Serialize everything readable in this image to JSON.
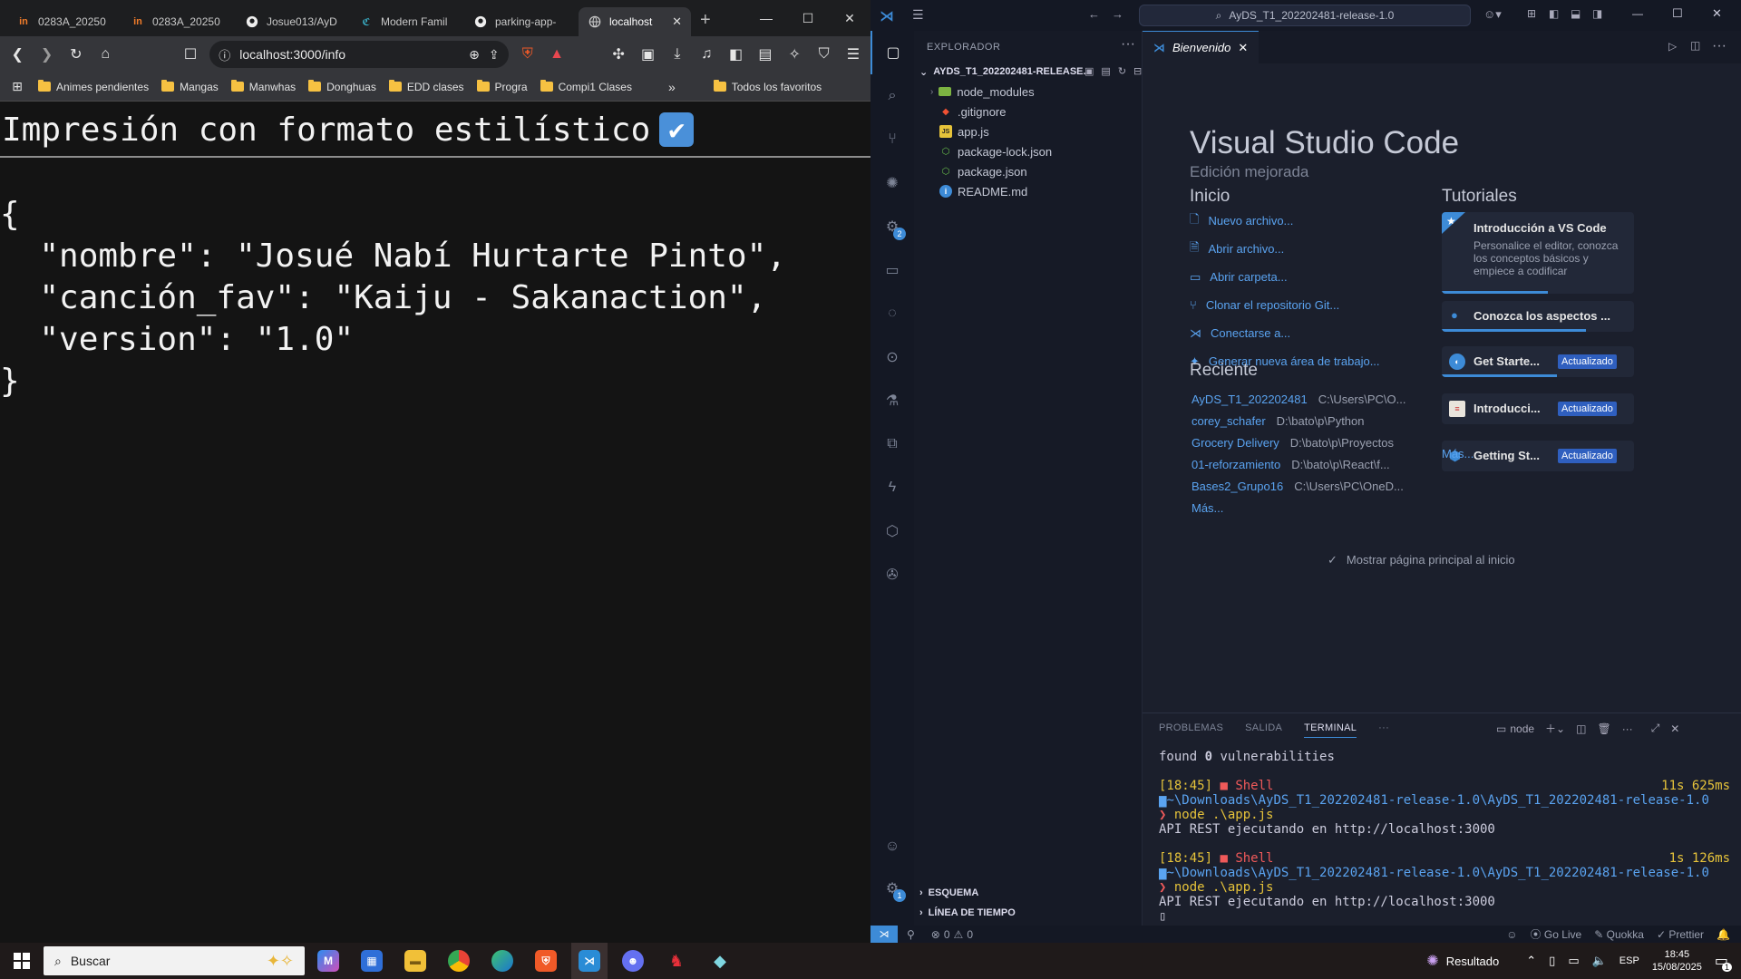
{
  "browser": {
    "tabs": [
      {
        "icon": "in",
        "label": "0283A_20250"
      },
      {
        "icon": "in",
        "label": "0283A_20250"
      },
      {
        "icon": "github",
        "label": "Josue013/AyD"
      },
      {
        "icon": "cm",
        "label": "Modern Famil"
      },
      {
        "icon": "github",
        "label": "parking-app-"
      },
      {
        "icon": "globe",
        "label": "localhost",
        "active": true
      }
    ],
    "url": "localhost:3000/info",
    "bookmarks": [
      "Animes pendientes",
      "Mangas",
      "Manwhas",
      "Donghuas",
      "EDD clases",
      "Progra",
      "Compi1 Clases"
    ],
    "bookmarks_more": "»",
    "all_favorites": "Todos los favoritos",
    "page": {
      "heading": "Impresión con formato estilístico",
      "check_glyph": "✔",
      "json_text": "{\n  \"nombre\": \"Josué Nabí Hurtarte Pinto\",\n  \"canción_fav\": \"Kaiju - Sakanaction\",\n  \"version\": \"1.0\"\n}"
    }
  },
  "vscode": {
    "search": "AyDS_T1_202202481-release-1.0",
    "explorer": {
      "title": "EXPLORADOR",
      "root": "AYDS_T1_202202481-RELEASE...",
      "items": [
        {
          "name": "node_modules",
          "icon": "folder"
        },
        {
          "name": ".gitignore",
          "icon": "git"
        },
        {
          "name": "app.js",
          "icon": "js"
        },
        {
          "name": "package-lock.json",
          "icon": "npm"
        },
        {
          "name": "package.json",
          "icon": "npm"
        },
        {
          "name": "README.md",
          "icon": "info"
        }
      ],
      "outline": "ESQUEMA",
      "timeline": "LÍNEA DE TIEMPO"
    },
    "editor_tab": "Bienvenido",
    "welcome": {
      "title": "Visual Studio Code",
      "subtitle": "Edición mejorada",
      "start_heading": "Inicio",
      "start_items": [
        "Nuevo archivo...",
        "Abrir archivo...",
        "Abrir carpeta...",
        "Clonar el repositorio Git...",
        "Conectarse a...",
        "Generar nueva área de trabajo..."
      ],
      "recent_heading": "Reciente",
      "recent": [
        {
          "name": "AyDS_T1_202202481",
          "path": "C:\\Users\\PC\\O..."
        },
        {
          "name": "corey_schafer",
          "path": "D:\\bato\\p\\Python"
        },
        {
          "name": "Grocery Delivery",
          "path": "D:\\bato\\p\\Proyectos"
        },
        {
          "name": "01-reforzamiento",
          "path": "D:\\bato\\p\\React\\f..."
        },
        {
          "name": "Bases2_Grupo16",
          "path": "C:\\Users\\PC\\OneD..."
        }
      ],
      "recent_more": "Más...",
      "tutorials_heading": "Tutoriales",
      "tutorials": [
        {
          "title": "Introducción a VS Code",
          "desc": "Personalice el editor, conozca los conceptos básicos y empiece a codificar",
          "progress": 0.55
        },
        {
          "title": "Conozca los aspectos ...",
          "progress": 0.75
        },
        {
          "title": "Get Starte...",
          "badge": "Actualizado",
          "progress": 0.6
        },
        {
          "title": "Introducci...",
          "badge": "Actualizado",
          "progress": 0
        },
        {
          "title": "Getting St...",
          "badge": "Actualizado",
          "progress": 0
        }
      ],
      "tutorials_more": "Más...",
      "show_on_start": "Mostrar página principal al inicio"
    },
    "panel": {
      "tabs": [
        "PROBLEMAS",
        "SALIDA",
        "TERMINAL"
      ],
      "more": "···",
      "shell_label": "node",
      "terminal": {
        "found_pre": "found ",
        "found_num": "0",
        "found_post": " vulnerabilities",
        "time1": "[18:45]",
        "shell": "Shell",
        "dur1": "11s 625ms",
        "path": "~\\Downloads\\AyDS_T1_202202481-release-1.0\\AyDS_T1_202202481-release-1.0",
        "cmd": "node .\\app.js",
        "out": "API REST ejecutando en http://localhost:3000",
        "time2": "[18:45]",
        "dur2": "1s 126ms"
      }
    },
    "status": {
      "errors": "0",
      "warnings": "0",
      "golive": "Go Live",
      "quokka": "Quokka",
      "prettier": "Prettier"
    }
  },
  "taskbar": {
    "search_placeholder": "Buscar",
    "weather": "Resultado",
    "lang": "ESP",
    "time": "18:45",
    "date": "15/08/2025",
    "notif_count": "1"
  }
}
